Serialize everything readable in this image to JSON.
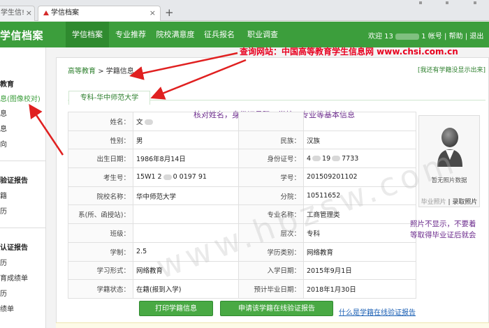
{
  "browser": {
    "tab1_title": "学生信!",
    "tab2_title": "学信档案",
    "new_tab_icon": "+"
  },
  "header": {
    "logo": "学信档案",
    "nav": [
      "学信档案",
      "专业推荐",
      "院校满意度",
      "征兵报名",
      "职业调查"
    ],
    "user_prefix": "欢迎 13",
    "user_suffix": "1 帐号",
    "help": "帮助",
    "logout": "退出"
  },
  "sidebar": {
    "items": [
      "教育",
      "息(图像校对)",
      "息",
      "息",
      "向",
      "验证报告",
      "籍",
      "历",
      "认证报告",
      "历",
      "育成绩单",
      "历",
      "绩单"
    ]
  },
  "main": {
    "breadcrumb_home": "高等教育",
    "breadcrumb_sep": ">",
    "breadcrumb_current": "学籍信息",
    "source_annotation": "查询网站：中国高等教育学生信息网 www.chsi.com.cn",
    "help_link": "[我还有学籍没显示出来]",
    "school_tab": "专科-华中师范大学",
    "annotation_check": "核对姓名，身份证号码，学校、专业等基本信息"
  },
  "table": {
    "rows": [
      [
        {
          "label": "姓名：",
          "value": "文"
        },
        {
          "label": "",
          "value": ""
        }
      ],
      [
        {
          "label": "性别：",
          "value": "男"
        },
        {
          "label": "民族：",
          "value": "汉族"
        }
      ],
      [
        {
          "label": "出生日期：",
          "value": "1986年8月14日"
        },
        {
          "label": "身份证号：",
          "value_a": "4",
          "value_b": "19",
          "value_c": "7733"
        }
      ],
      [
        {
          "label": "考生号：",
          "value_a": "15W1 2",
          "value_b": "0 0197 91"
        },
        {
          "label": "学号：",
          "value": "201509201102"
        }
      ],
      [
        {
          "label": "院校名称：",
          "value": "华中师范大学"
        },
        {
          "label": "分院：",
          "value": "10511652"
        }
      ],
      [
        {
          "label": "系(所、函授站)：",
          "value": ""
        },
        {
          "label": "专业名称：",
          "value": "工商管理类"
        }
      ],
      [
        {
          "label": "班级：",
          "value": ""
        },
        {
          "label": "层次：",
          "value": "专科"
        }
      ],
      [
        {
          "label": "学制：",
          "value": "2.5"
        },
        {
          "label": "学历类别：",
          "value": "网络教育"
        }
      ],
      [
        {
          "label": "学习形式：",
          "value": "网络教育"
        },
        {
          "label": "入学日期：",
          "value": "2015年9月1日"
        }
      ],
      [
        {
          "label": "学籍状态：",
          "value": "在籍(报到入学)"
        },
        {
          "label": "预计毕业日期：",
          "value": "2018年1月30日"
        }
      ]
    ]
  },
  "photo": {
    "no_photo": "暂无照片数据",
    "grad_photo": "毕业照片",
    "entry_photo": "录取照片",
    "icon": "user-avatar-icon",
    "annotation_line1": "照片不显示，不要着",
    "annotation_line2": "等取得毕业证后就会"
  },
  "buttons": {
    "print": "打印学籍信息",
    "apply": "申请该学籍在线验证报告",
    "what_link": "什么是学籍在线验证报告"
  },
  "watermark": "www.hbzsw.com",
  "colors": {
    "brand_green": "#3c9e3c",
    "annotation_red": "#e8001f",
    "annotation_purple": "#6b2a8c",
    "link_blue": "#1a5fb4"
  }
}
